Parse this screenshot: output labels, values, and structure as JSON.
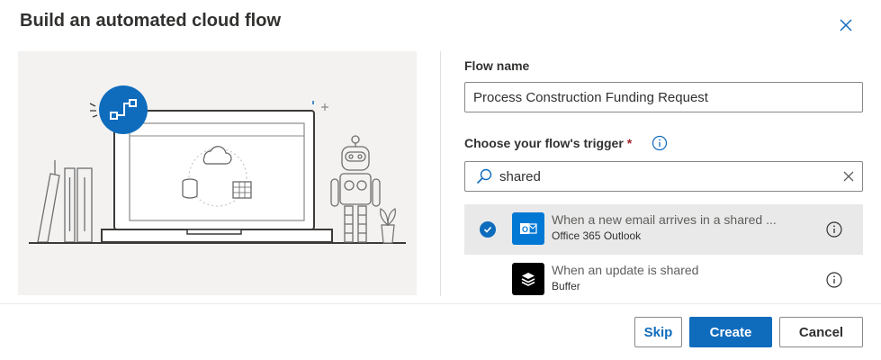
{
  "dialog": {
    "title": "Build an automated cloud flow",
    "close_icon": "close-icon"
  },
  "form": {
    "flow_name_label": "Flow name",
    "flow_name_value": "Process Construction Funding Request",
    "trigger_label": "Choose your flow's trigger",
    "required_marker": "*",
    "search_value": "shared"
  },
  "triggers": [
    {
      "title": "When a new email arrives in a shared ...",
      "connector": "Office 365 Outlook",
      "icon": "outlook-icon",
      "icon_color": "#0078d4",
      "selected": true
    },
    {
      "title": "When an update is shared",
      "connector": "Buffer",
      "icon": "buffer-icon",
      "icon_color": "#000000",
      "selected": false
    }
  ],
  "buttons": {
    "skip": "Skip",
    "create": "Create",
    "cancel": "Cancel"
  },
  "colors": {
    "accent": "#0f6cbd",
    "illustration_bg": "#f3f2f1",
    "required": "#a4262c"
  }
}
